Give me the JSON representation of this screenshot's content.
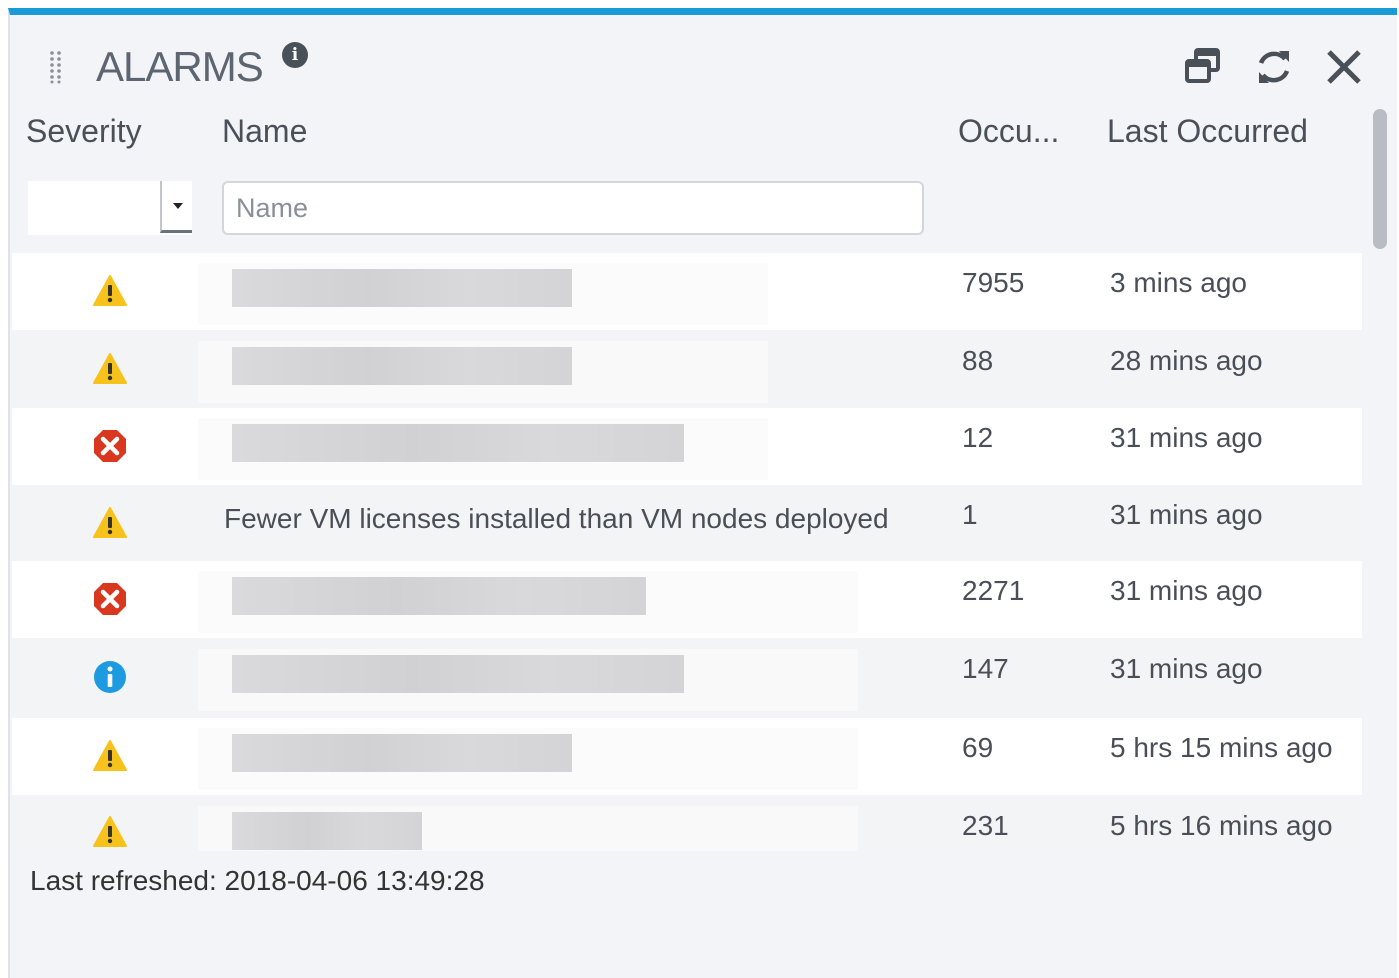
{
  "panel": {
    "title": "ALARMS",
    "info_badge": "i",
    "accent_color": "#1a9ad6",
    "buttons": [
      {
        "name": "popout-button",
        "icon": "popout-icon"
      },
      {
        "name": "refresh-button",
        "icon": "refresh-icon"
      },
      {
        "name": "close-button",
        "icon": "close-icon"
      }
    ]
  },
  "columns": {
    "severity": "Severity",
    "name": "Name",
    "occurrences": "Occu...",
    "last_occurred": "Last Occurred"
  },
  "filters": {
    "severity_value": "",
    "name_placeholder": "Name"
  },
  "rows": [
    {
      "severity": "warning",
      "name": "",
      "name_redacted": true,
      "occurrences": "7955",
      "last_occurred": "3 mins ago"
    },
    {
      "severity": "warning",
      "name": "",
      "name_redacted": true,
      "occurrences": "88",
      "last_occurred": "28 mins ago"
    },
    {
      "severity": "critical",
      "name": "",
      "name_redacted": true,
      "occurrences": "12",
      "last_occurred": "31 mins ago"
    },
    {
      "severity": "warning",
      "name": "Fewer VM licenses installed than VM nodes deployed",
      "name_redacted": false,
      "occurrences": "1",
      "last_occurred": "31 mins ago"
    },
    {
      "severity": "critical",
      "name": "",
      "name_redacted": true,
      "occurrences": "2271",
      "last_occurred": "31 mins ago"
    },
    {
      "severity": "info",
      "name": "",
      "name_redacted": true,
      "occurrences": "147",
      "last_occurred": "31 mins ago"
    },
    {
      "severity": "warning",
      "name": "",
      "name_redacted": true,
      "occurrences": "69",
      "last_occurred": "5 hrs 15 mins ago"
    },
    {
      "severity": "warning",
      "name": "",
      "name_redacted": true,
      "occurrences": "231",
      "last_occurred": "5 hrs 16 mins ago"
    }
  ],
  "footer": {
    "last_refreshed": "Last refreshed: 2018-04-06 13:49:28"
  },
  "colors": {
    "warning": "#f8c21c",
    "critical": "#d9381e",
    "info": "#1e9be0"
  }
}
